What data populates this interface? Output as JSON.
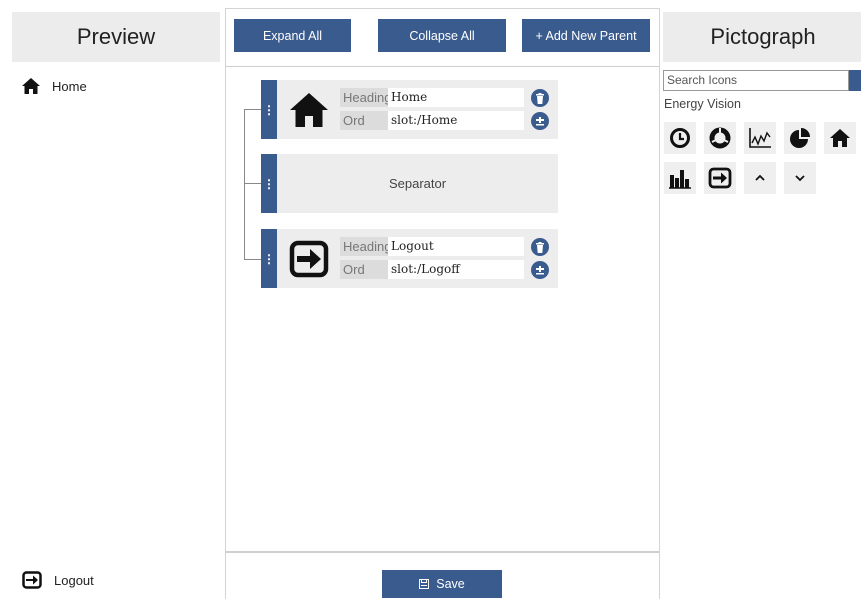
{
  "preview": {
    "title": "Preview",
    "items": [
      {
        "label": "Home",
        "icon": "home-icon"
      },
      {
        "label": "Logout",
        "icon": "logout-icon"
      }
    ]
  },
  "toolbar": {
    "expand_label": "Expand All",
    "collapse_label": "Collapse All",
    "add_parent_label": "+ Add New Parent"
  },
  "nodes": [
    {
      "type": "item",
      "icon": "home-icon",
      "heading_label": "Heading",
      "heading_value": "Home",
      "ord_label": "Ord",
      "ord_value": "slot:/Home"
    },
    {
      "type": "separator",
      "label": "Separator"
    },
    {
      "type": "item",
      "icon": "logout-icon",
      "heading_label": "Heading",
      "heading_value": "Logout",
      "ord_label": "Ord",
      "ord_value": "slot:/Logoff"
    }
  ],
  "footer": {
    "save_label": "Save"
  },
  "pictograph": {
    "title": "Pictograph",
    "search_placeholder": "Search Icons",
    "group": "Energy Vision",
    "icons": [
      "clock-icon",
      "donut-icon",
      "line-chart-icon",
      "pie-chart-icon",
      "home-icon",
      "bar-chart-icon",
      "logout-icon",
      "chevron-up-icon",
      "chevron-down-icon"
    ]
  },
  "colors": {
    "accent": "#3a5b8e",
    "panel": "#ececec"
  }
}
